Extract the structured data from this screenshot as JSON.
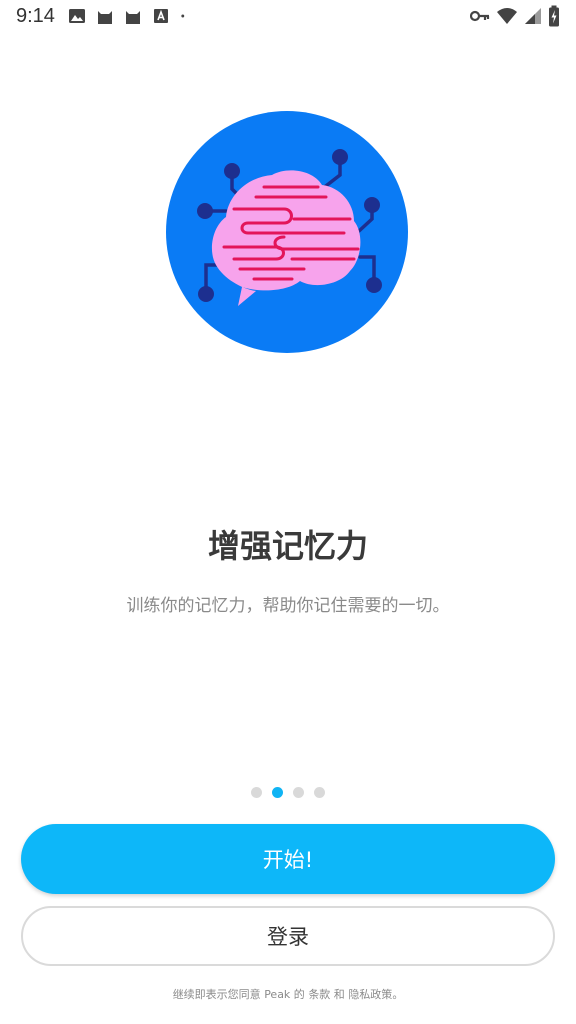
{
  "status_bar": {
    "time": "9:14",
    "left_icons": [
      "image-icon",
      "cat-icon",
      "cat-icon",
      "font-icon",
      "dot-icon"
    ],
    "right_icons": [
      "vpn-key-icon",
      "wifi-icon",
      "signal-icon",
      "battery-charging-icon"
    ]
  },
  "onboarding": {
    "headline": "增强记忆力",
    "subline": "训练你的记忆力，帮助你记住需要的一切。",
    "illustration": "brain-memory-icon",
    "pages": 4,
    "active_page": 2
  },
  "actions": {
    "start_label": "开始!",
    "login_label": "登录"
  },
  "footer": {
    "prefix": "继续即表示您同意 ",
    "brand": "Peak",
    "mid1": " 的 ",
    "terms_link": "条款",
    "mid2": " 和 ",
    "privacy_link": "隐私政策",
    "suffix": "。"
  },
  "colors": {
    "primary": "#0db7f9",
    "active_dot": "#10b4f4",
    "circle_blue": "#0a7bf5",
    "brain_pink": "#f7a3ec",
    "brain_lines": "#e3155a",
    "circuit_navy": "#1d2f8f"
  }
}
